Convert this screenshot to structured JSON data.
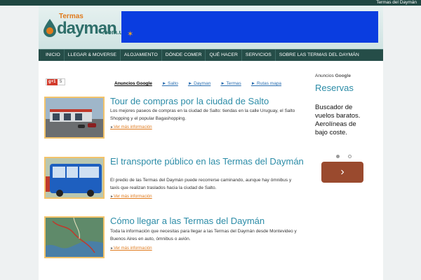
{
  "topbar": {
    "site_link": "Termas del Daymán"
  },
  "logo": {
    "small": "Termas",
    "main": "dayman",
    "domain": ".com.uy"
  },
  "nav": [
    "INICIO",
    "LLEGAR & MOVERSE",
    "ALOJAMIENTO",
    "DÓNDE COMER",
    "QUÉ HACER",
    "SERVICIOS",
    "SOBRE LAS TERMAS DEL DAYMÁN"
  ],
  "gplus": {
    "label": "g+1",
    "count": "5"
  },
  "ad_links": {
    "label": "Anuncios Google",
    "items": [
      "► Salto",
      "► Dayman",
      "► Termas",
      "► Rutas mapa"
    ]
  },
  "articles": [
    {
      "title": "Tour de compras por la ciudad de Salto",
      "text": "Los mejores paseos de compras en la ciudad de Salto: tiendas en la calle Uruguay, el Salto Shopping y el popular Bagashopping.",
      "more": "Ver más información"
    },
    {
      "title": "El transporte público en las Termas del Daymán",
      "text": "El predio de las Termas del Daymán puede recorrerse caminando, aunque hay ómnibus y taxis que realizan traslados hacia la ciudad de Salto.",
      "more": "Ver más información"
    },
    {
      "title": "Cómo llegar a las Termas del Daymán",
      "text": "Toda la información que necesitas para llegar a las Termas del Daymán desde Montevideo y Buenos Aires en auto, ómnibus o avión.",
      "more": "Ver más información"
    }
  ],
  "sidebar": {
    "ads_label": "Anuncios",
    "ads_brand": "Google",
    "title": "Reservas",
    "text": "Buscador de vuelos baratos. Aerolíneas de bajo coste.",
    "next_glyph": "›"
  },
  "colors": {
    "nav_bg": "#254d48",
    "title_color": "#2c8ca7",
    "link_orange": "#e07a1c",
    "ad_banner": "#0a3de0",
    "button": "#9a4a2e"
  }
}
